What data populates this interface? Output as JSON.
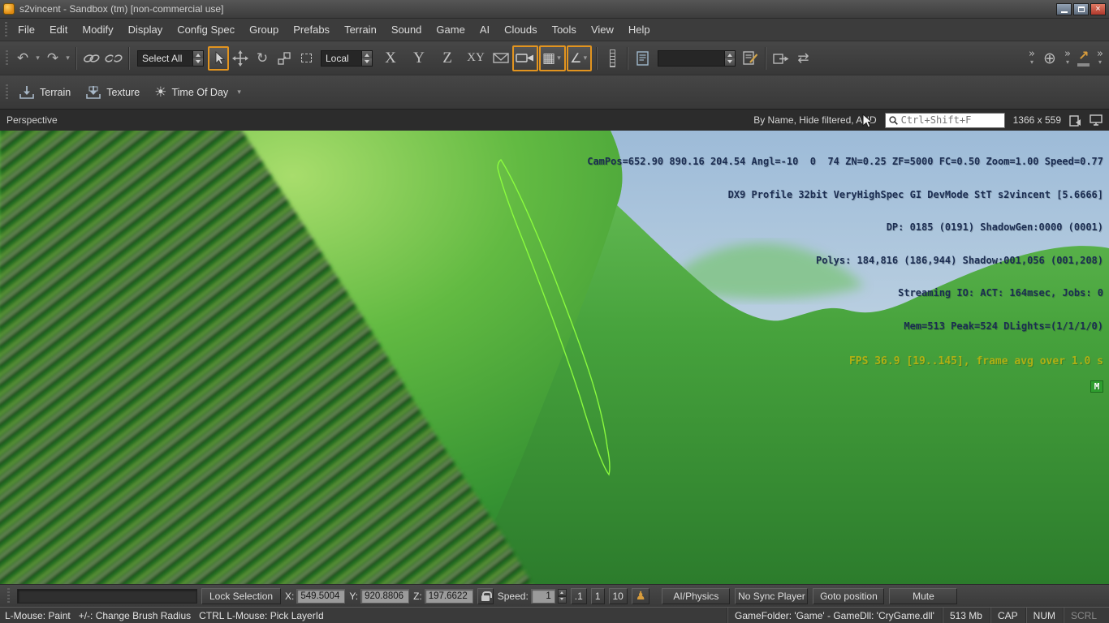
{
  "colors": {
    "accent": "#e2941f",
    "selection": "#8dff3e",
    "debug_text": "#1b2d52",
    "fps_text": "#b0b014",
    "badge_bg": "#2f9e2f"
  },
  "icons": {
    "undo": "↶",
    "redo": "↷",
    "rotate": "↻",
    "snap_grid": "▦",
    "snap_angle": "∠",
    "sun": "☀",
    "globe": "⊕",
    "sync": "⇄",
    "player": "♟",
    "player_arrow": "↗",
    "overflow": "»",
    "caret": "▾"
  },
  "titlebar": {
    "title": "s2vincent - Sandbox (tm) [non-commercial use]"
  },
  "menubar": {
    "items": [
      "File",
      "Edit",
      "Modify",
      "Display",
      "Config Spec",
      "Group",
      "Prefabs",
      "Terrain",
      "Sound",
      "Game",
      "AI",
      "Clouds",
      "Tools",
      "View",
      "Help"
    ]
  },
  "toolbar": {
    "select_filter": "Select All",
    "coord_system": "Local",
    "axis_x": "X",
    "axis_y": "Y",
    "axis_z": "Z",
    "axis_xy": "XY"
  },
  "shelf": {
    "terrain": "Terrain",
    "texture": "Texture",
    "time_of_day": "Time Of Day"
  },
  "viewport": {
    "label": "Perspective",
    "filter_label": "By Name, Hide filtered, AND",
    "search_placeholder": "Ctrl+Shift+F",
    "resolution": "1366 x 559",
    "debug_lines": [
      "CamPos=652.90 890.16 204.54 Angl=-10  0  74 ZN=0.25 ZF=5000 FC=0.50 Zoom=1.00 Speed=0.77",
      "DX9 Profile 32bit VeryHighSpec GI DevMode StT s2vincent [5.6666]",
      "DP: 0185 (0191) ShadowGen:0000 (0001)",
      "Polys: 184,816 (186,944) Shadow:001,056 (001,208)",
      "Streaming IO: ACT: 164msec, Jobs: 0",
      "Mem=513 Peak=524 DLights=(1/1/1/0)"
    ],
    "fps_line": "FPS 36.9 [19..145], frame avg over 1.0 s",
    "badge": "M"
  },
  "bottombar": {
    "lock_selection": "Lock Selection",
    "x_label": "X:",
    "x_value": "549.5004",
    "y_label": "Y:",
    "y_value": "920.8806",
    "z_label": "Z:",
    "z_value": "197.6622",
    "speed_label": "Speed:",
    "speed_value": "1",
    "speed_preset_01": ".1",
    "speed_preset_1": "1",
    "speed_preset_10": "10",
    "ai_physics": "AI/Physics",
    "no_sync": "No Sync Player",
    "goto_position": "Goto position",
    "mute": "Mute"
  },
  "statusbar": {
    "hint": "L-Mouse: Paint   +/-: Change Brush Radius   CTRL L-Mouse: Pick LayerId",
    "game_info": "GameFolder: 'Game' - GameDll: 'CryGame.dll'",
    "memory": "513 Mb",
    "cap": "CAP",
    "num": "NUM",
    "scrl": "SCRL"
  }
}
